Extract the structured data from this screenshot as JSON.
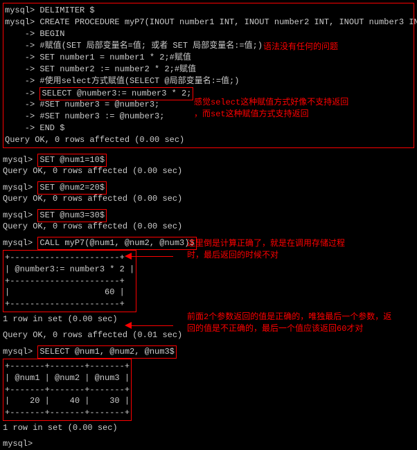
{
  "block1": {
    "l1": "mysql> DELIMITER $",
    "l2": "mysql> CREATE PROCEDURE myP7(INOUT number1 INT, INOUT number2 INT, INOUT number3 INT)",
    "l3": "    -> BEGIN",
    "l4": "    -> #赋值(SET 局部变量名=值; 或者 SET 局部变量名:=值;)",
    "l5": "    -> SET number1 = number1 * 2;#赋值",
    "l6": "    -> SET number2 := number2 * 2;#赋值",
    "l7": "    -> #使用select方式赋值(SELECT @局部变量名:=值;)",
    "l8label": "    -> ",
    "l8box": "SELECT @number3:= number3 * 2;",
    "l9": "    -> #SET number3 = @number3;",
    "l10": "    -> #SET number3 := @number3;",
    "l11": "    -> END $",
    "l12": "Query OK, 0 rows affected (0.00 sec)"
  },
  "ann1": "语法没有任何的问题",
  "ann2a": "感觉select这种赋值方式好像不支持返回",
  "ann2b": "，而set这种赋值方式支持返回",
  "set1": {
    "prompt": "mysql> ",
    "cmd": "SET @num1=10$",
    "result": "Query OK, 0 rows affected (0.00 sec)"
  },
  "set2": {
    "prompt": "mysql> ",
    "cmd": "SET @num2=20$",
    "result": "Query OK, 0 rows affected (0.00 sec)"
  },
  "set3": {
    "prompt": "mysql> ",
    "cmd": "SET @num3=30$",
    "result": "Query OK, 0 rows affected (0.00 sec)"
  },
  "call": {
    "prompt": "mysql> ",
    "cmd": "CALL myP7(@num1, @num2, @num3)$"
  },
  "table1": {
    "border": "+----------------------+",
    "header": "| @number3:= number3 * 2 |",
    "row": "|                   60 |",
    "footer": "1 row in set (0.00 sec)"
  },
  "midresult": "Query OK, 0 rows affected (0.01 sec)",
  "select": {
    "prompt": "mysql> ",
    "cmd": "SELECT @num1, @num2, @num3$"
  },
  "table2": {
    "border": "+-------+-------+-------+",
    "header": "| @num1 | @num2 | @num3 |",
    "row": "|    20 |    40 |    30 |",
    "footer": "1 row in set (0.00 sec)"
  },
  "ann3a": "这里倒是计算正确了，就是在调用存储过程",
  "ann3b": "时，最后返回的时候不对",
  "ann4a": "前面2个参数返回的值是正确的，唯独最后一个参数，返",
  "ann4b": "回的值是不正确的，最后一个值应该返回60才对",
  "finalprompt": "mysql>"
}
